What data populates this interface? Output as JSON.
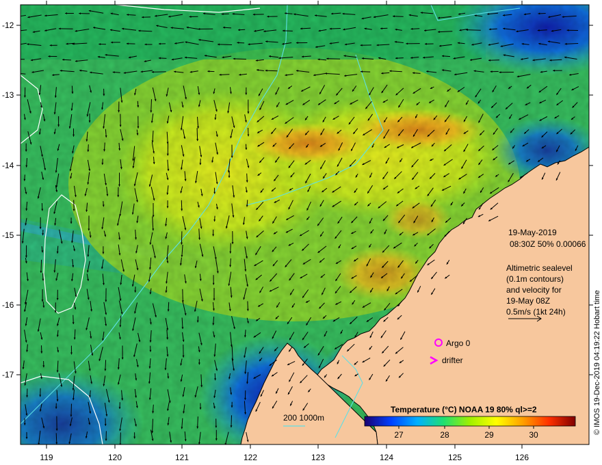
{
  "map": {
    "lat_ticks": [
      "-12",
      "-13",
      "-14",
      "-15",
      "-16",
      "-17"
    ],
    "lon_ticks": [
      "119",
      "120",
      "121",
      "122",
      "123",
      "124",
      "125",
      "126"
    ],
    "colors": {
      "land": "#f7c79d",
      "coast": "#000000",
      "contour": "#5ee0e6",
      "sealevel_contour": "#ffffff",
      "marker": "#ff00ff"
    }
  },
  "info": {
    "date": "19-May-2019",
    "time_line": "08:30Z  50% 0.00066",
    "altimetry": [
      "Altimetric sealevel",
      "(0.1m contours)",
      "and velocity for",
      "19-May 08Z",
      "0.5m/s (1kt 24h)"
    ]
  },
  "legend": {
    "argo_label": "Argo 0",
    "drifter_label": "drifter",
    "bathy_label": "200  1000m"
  },
  "colorbar": {
    "title": "Temperature (°C) NOAA 19 80% ql>=2",
    "ticks": [
      "27",
      "28",
      "29",
      "30"
    ],
    "stops": [
      "#1a0070",
      "#0040ff",
      "#00b0ff",
      "#20e070",
      "#a0f000",
      "#ffff00",
      "#ffa000",
      "#ff3000",
      "#800000"
    ]
  },
  "credit": "© IMOS 19-Dec-2019 04:19:22 Hobart time"
}
